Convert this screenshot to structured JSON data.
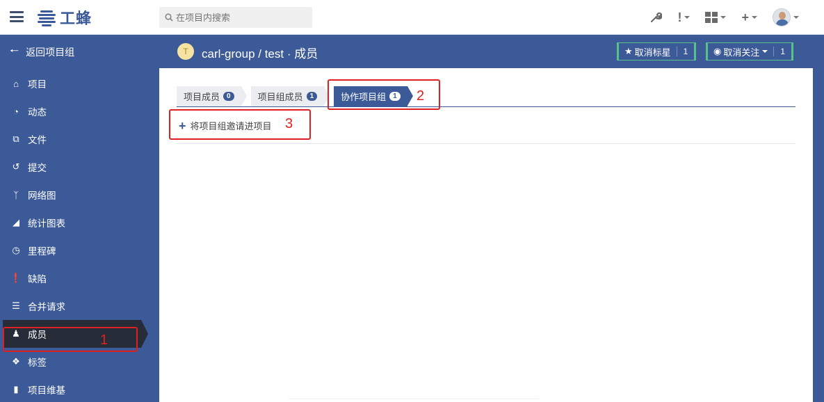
{
  "header": {
    "logo_text": "工蜂",
    "search_placeholder": "在项目内搜索"
  },
  "sidebar": {
    "back_label": "返回项目组",
    "items": [
      {
        "label": "项目",
        "icon": "home-icon"
      },
      {
        "label": "动态",
        "icon": "dashboard-icon"
      },
      {
        "label": "文件",
        "icon": "files-icon"
      },
      {
        "label": "提交",
        "icon": "history-icon"
      },
      {
        "label": "网络图",
        "icon": "branch-icon"
      },
      {
        "label": "统计图表",
        "icon": "area-chart-icon"
      },
      {
        "label": "里程碑",
        "icon": "clock-icon"
      },
      {
        "label": "缺陷",
        "icon": "exclamation-icon"
      },
      {
        "label": "合并请求",
        "icon": "merge-request-icon"
      },
      {
        "label": "成员",
        "icon": "users-icon",
        "active": true
      },
      {
        "label": "标签",
        "icon": "tags-icon"
      },
      {
        "label": "项目维基",
        "icon": "book-icon"
      }
    ]
  },
  "project": {
    "avatar_letter": "T",
    "title": "carl-group / test · 成员",
    "unstar_label": "取消标星",
    "star_count": "1",
    "unwatch_label": "取消关注",
    "watch_count": "1"
  },
  "tabs": [
    {
      "label": "项目成员",
      "count": "0"
    },
    {
      "label": "项目组成员",
      "count": "1"
    },
    {
      "label": "协作项目组",
      "count": "1",
      "active": true
    }
  ],
  "invite_label": "将项目组邀请进项目",
  "annotations": {
    "n1": "1",
    "n2": "2",
    "n3": "3"
  },
  "colors": {
    "primary": "#3d5a98",
    "active_dark": "#262c38",
    "annotation_red": "#e02020",
    "button_green": "#58c28a"
  }
}
